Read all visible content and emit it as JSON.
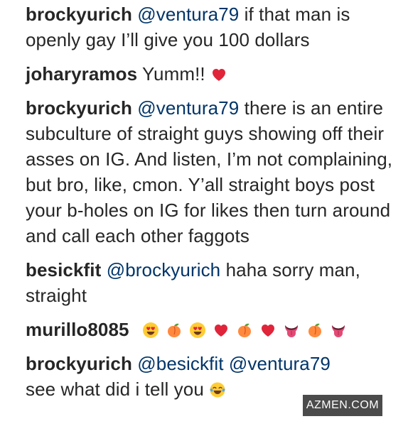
{
  "comments": [
    {
      "username": "brockyurich",
      "mentions": [
        "@ventura79"
      ],
      "text": " if that man is openly gay I’ll give you 100 dollars"
    },
    {
      "username": "joharyramos",
      "text": " Yumm!! ",
      "emojis": [
        "red-heart"
      ]
    },
    {
      "username": "brockyurich",
      "mentions": [
        "@ventura79"
      ],
      "text": " there is an entire subculture of straight guys showing off their asses on IG. And listen, I’m not complaining, but bro, like, cmon. Y’all straight boys post your b-holes on IG for likes then turn around and call each other faggots"
    },
    {
      "username": "besickfit",
      "mentions": [
        "@brockyurich"
      ],
      "text": " haha sorry man, straight"
    },
    {
      "username": "murillo8085",
      "emojis": [
        "heart-eyes",
        "peach",
        "heart-eyes",
        "red-heart",
        "peach",
        "red-heart",
        "tongue",
        "peach",
        "tongue"
      ]
    },
    {
      "username": "brockyurich",
      "mentions": [
        "@besickfit",
        "@ventura79"
      ],
      "text": "see what did i tell you ",
      "emojis": [
        "tears-of-joy"
      ]
    }
  ],
  "watermark": "AZMEN.COM",
  "colors": {
    "username": "#262626",
    "mention": "#003569",
    "text": "#262626"
  }
}
